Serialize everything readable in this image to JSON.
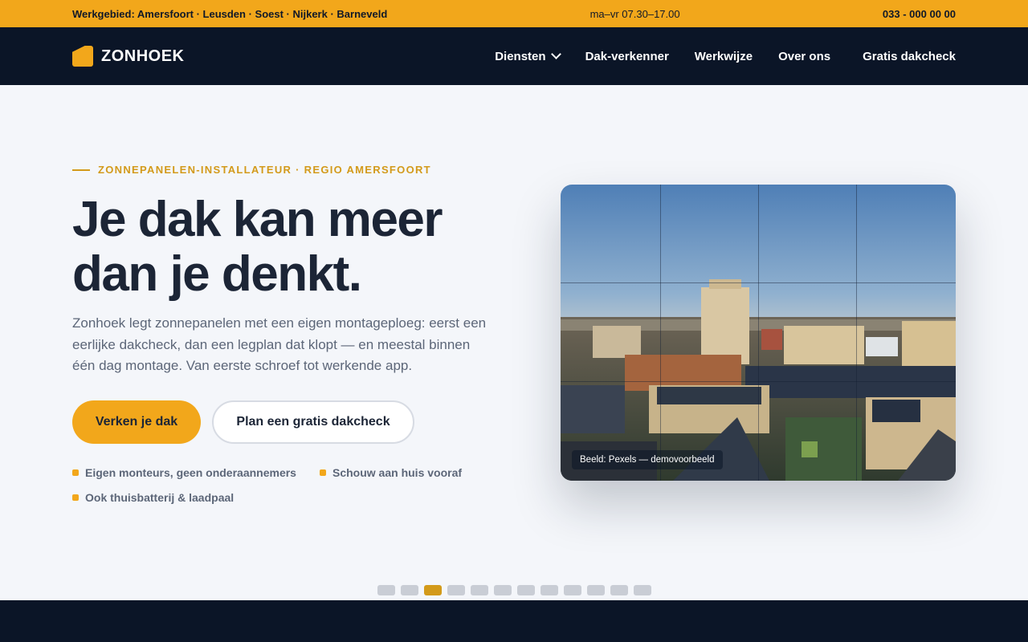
{
  "topbar": {
    "region": "Werkgebied: Amersfoort · Leusden · Soest · Nijkerk · Barneveld",
    "hours": "ma–vr 07.30–17.00",
    "phone": "033 - 000 00 00"
  },
  "nav": {
    "brand": "ZONHOEK",
    "items": [
      {
        "label": "Diensten"
      },
      {
        "label": "Dak-verkenner"
      },
      {
        "label": "Werkwijze"
      },
      {
        "label": "Over ons"
      }
    ],
    "cta": "Gratis dakcheck"
  },
  "hero": {
    "eyebrow": "ZONNEPANELEN-INSTALLATEUR · REGIO AMERSFOORT",
    "headline_line1": "Je dak kan meer",
    "headline_line2": "dan je denkt.",
    "intro": "Zonhoek legt zonnepanelen met een eigen montageploeg: eerst een eerlijke dakcheck, dan een legplan dat klopt — en meestal binnen één dag montage. Van eerste schroef tot werkende app.",
    "primary_button": "Verken je dak",
    "secondary_button": "Plan een gratis dakcheck",
    "features": [
      "Eigen monteurs, geen onderaannemers",
      "Schouw aan huis vooraf",
      "Ook thuisbatterij & laadpaal"
    ],
    "image_caption": "Beeld: Pexels — demovoorbeeld"
  },
  "carousel": {
    "count": 12,
    "active_index": 2
  },
  "colors": {
    "accent": "#f2a71b",
    "navy": "#0b1527",
    "text": "#1c2536",
    "muted": "#5c6678"
  }
}
